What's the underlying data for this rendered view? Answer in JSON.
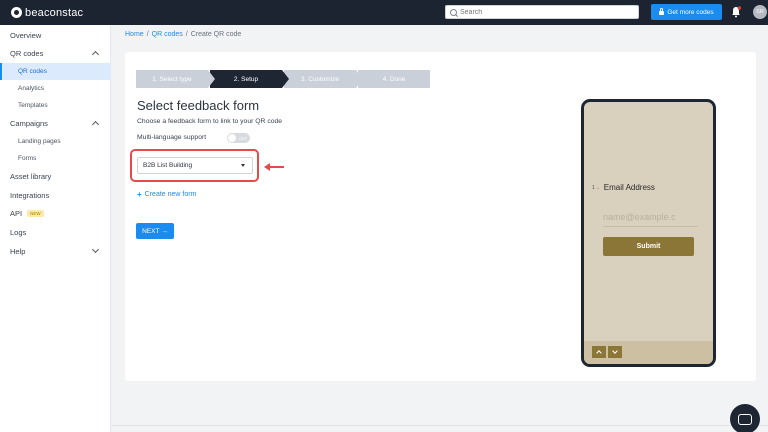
{
  "topbar": {
    "brand": "beaconstac",
    "search_placeholder": "Search",
    "get_more_label": "Get more codes",
    "avatar_initials": "SR"
  },
  "sidebar": {
    "overview": "Overview",
    "qr_codes": "QR codes",
    "qr_codes_sub": [
      "QR codes",
      "Analytics",
      "Templates"
    ],
    "campaigns": "Campaigns",
    "campaigns_sub": [
      "Landing pages",
      "Forms"
    ],
    "asset_library": "Asset library",
    "integrations": "Integrations",
    "api": "API",
    "api_badge": "NEW",
    "logs": "Logs",
    "help": "Help"
  },
  "breadcrumb": {
    "home": "Home",
    "sep": "/",
    "qr_codes": "QR codes",
    "current": "Create QR code"
  },
  "stepper": {
    "steps": [
      "1. Select type",
      "2. Setup",
      "3. Customize",
      "4. Done"
    ],
    "active_index": 1
  },
  "form": {
    "title": "Select feedback form",
    "description": "Choose a feedback form to link to your QR code",
    "multi_language_label": "Multi-language support",
    "toggle_text": "OFF",
    "selected_form": "B2B List Building",
    "create_new_label": "Create new form",
    "next_label": "NEXT",
    "next_arrow": "→"
  },
  "preview": {
    "question_number": "1→",
    "question_label": "Email Address",
    "email_placeholder": "name@example.c",
    "submit_label": "Submit"
  },
  "colors": {
    "accent": "#1a8cf0",
    "highlight": "#e84a4a",
    "phone_bg": "#d9d0bd",
    "submit_bg": "#8c7637"
  }
}
